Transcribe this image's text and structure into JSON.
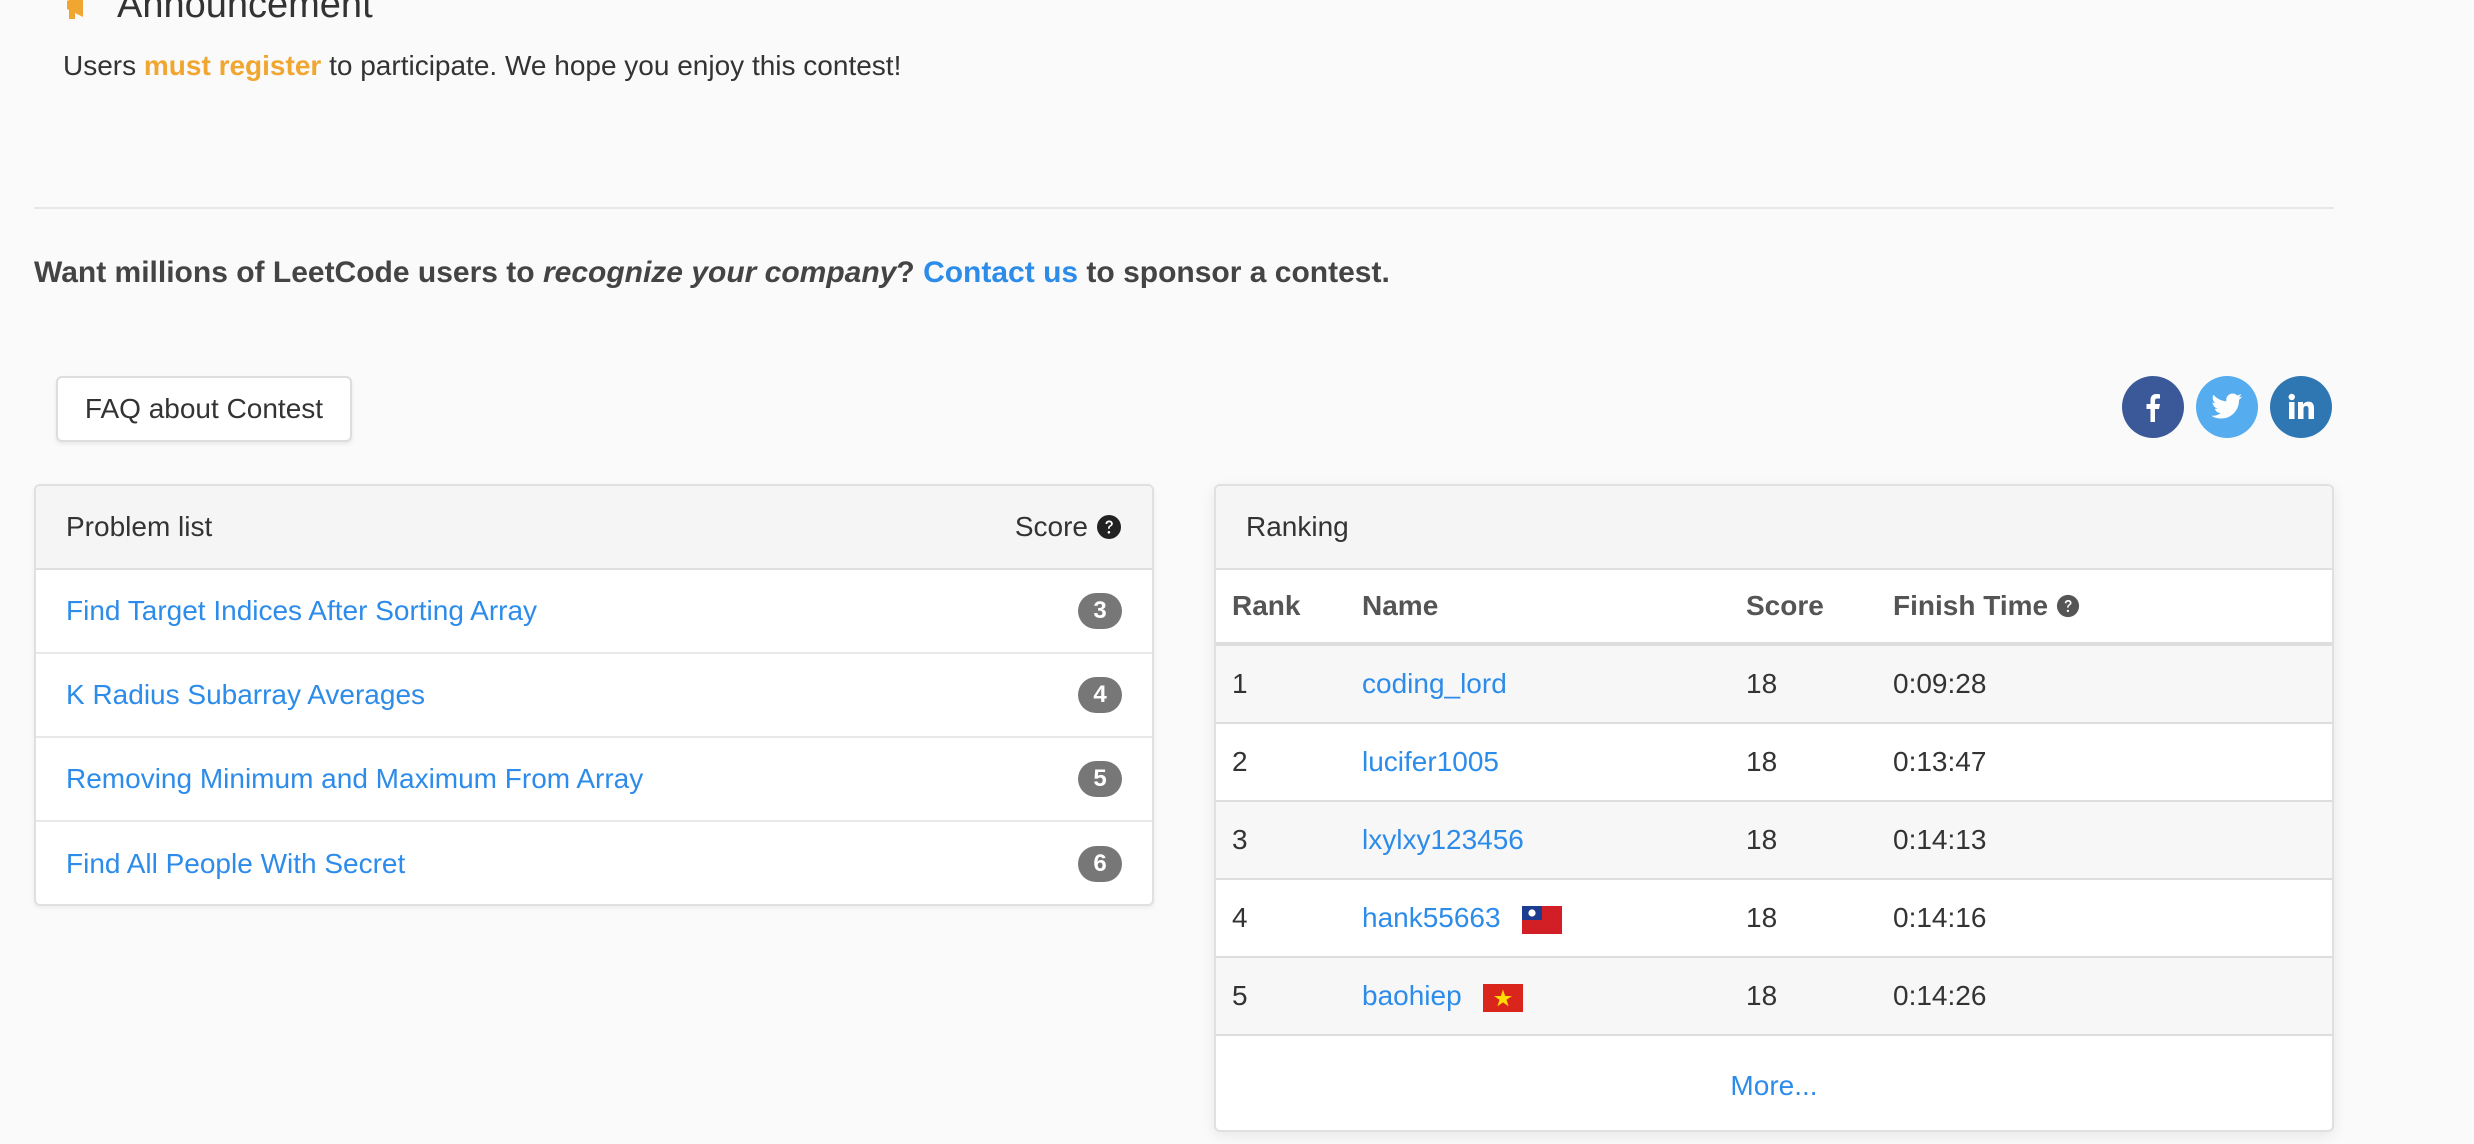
{
  "announcement": {
    "title": "Announcement",
    "text_before": "Users",
    "text_emph": "must register",
    "text_after": "to participate. We hope you enjoy this contest!"
  },
  "sponsor": {
    "part1": "Want millions of LeetCode users to",
    "emph": "recognize your company",
    "part2": "?",
    "link": "Contact us",
    "part3": "to sponsor a contest."
  },
  "faq_button": "FAQ about Contest",
  "social": [
    "facebook-icon",
    "twitter-icon",
    "linkedin-icon"
  ],
  "problems": {
    "header": "Problem list",
    "score_header": "Score",
    "items": [
      {
        "title": "Find Target Indices After Sorting Array",
        "score": "3"
      },
      {
        "title": "K Radius Subarray Averages",
        "score": "4"
      },
      {
        "title": "Removing Minimum and Maximum From Array",
        "score": "5"
      },
      {
        "title": "Find All People With Secret",
        "score": "6"
      }
    ]
  },
  "ranking": {
    "header": "Ranking",
    "columns": [
      "Rank",
      "Name",
      "Score",
      "Finish Time"
    ],
    "rows": [
      {
        "rank": "1",
        "name": "coding_lord",
        "score": "18",
        "time": "0:09:28",
        "flag": ""
      },
      {
        "rank": "2",
        "name": "lucifer1005",
        "score": "18",
        "time": "0:13:47",
        "flag": ""
      },
      {
        "rank": "3",
        "name": "lxylxy123456",
        "score": "18",
        "time": "0:14:13",
        "flag": ""
      },
      {
        "rank": "4",
        "name": "hank55663",
        "score": "18",
        "time": "0:14:16",
        "flag": "taiwan-flag"
      },
      {
        "rank": "5",
        "name": "baohiep",
        "score": "18",
        "time": "0:14:26",
        "flag": "vietnam-flag"
      }
    ],
    "more": "More..."
  },
  "colors": {
    "link": "#2d8ce9",
    "accent": "#f0a630",
    "badge": "#777777",
    "facebook": "#3b5998",
    "twitter": "#55acee",
    "linkedin": "#2f77b3"
  }
}
